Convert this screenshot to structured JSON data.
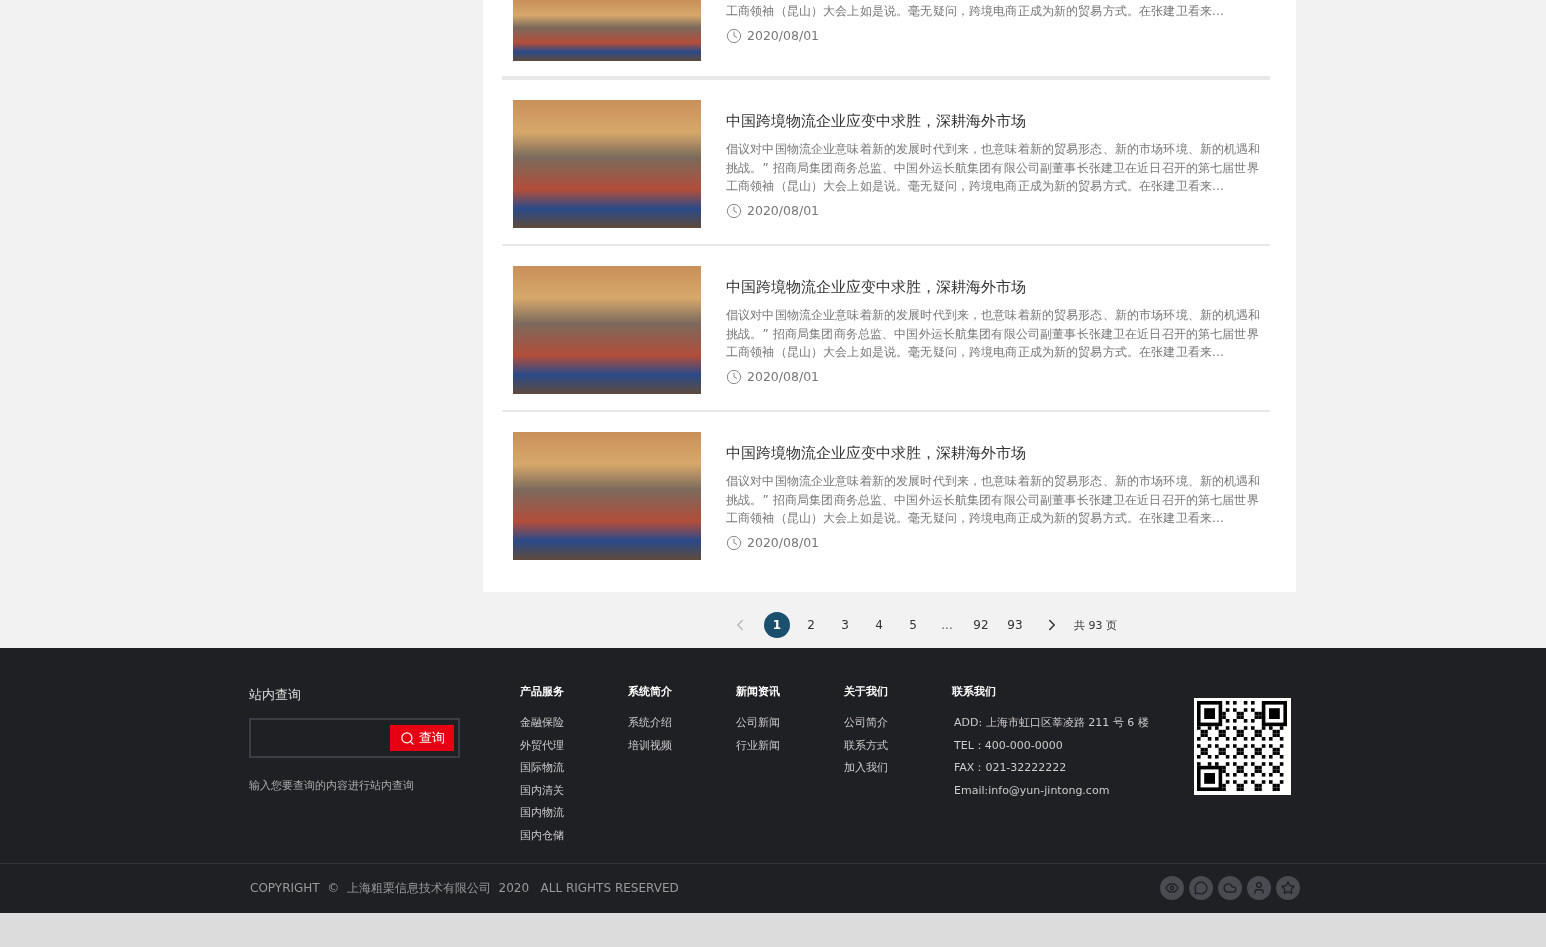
{
  "articles": [
    {
      "partial": true,
      "excerpt": "工商领袖（昆山）大会上如是说。毫无疑问，跨境电商正成为新的贸易方式。在张建卫看来...",
      "date": "2020/08/01"
    },
    {
      "partial": false,
      "title": "中国跨境物流企业应变中求胜，深耕海外市场",
      "excerpt": "倡议对中国物流企业意味着新的发展时代到来，也意味着新的贸易形态、新的市场环境、新的机遇和挑战。” 招商局集团商务总监、中国外运长航集团有限公司副董事长张建卫在近日召开的第七届世界工商领袖（昆山）大会上如是说。毫无疑问，跨境电商正成为新的贸易方式。在张建卫看来...",
      "date": "2020/08/01"
    },
    {
      "partial": false,
      "title": "中国跨境物流企业应变中求胜，深耕海外市场",
      "excerpt": "倡议对中国物流企业意味着新的发展时代到来，也意味着新的贸易形态、新的市场环境、新的机遇和挑战。” 招商局集团商务总监、中国外运长航集团有限公司副董事长张建卫在近日召开的第七届世界工商领袖（昆山）大会上如是说。毫无疑问，跨境电商正成为新的贸易方式。在张建卫看来...",
      "date": "2020/08/01"
    },
    {
      "partial": false,
      "title": "中国跨境物流企业应变中求胜，深耕海外市场",
      "excerpt": "倡议对中国物流企业意味着新的发展时代到来，也意味着新的贸易形态、新的市场环境、新的机遇和挑战。” 招商局集团商务总监、中国外运长航集团有限公司副董事长张建卫在近日召开的第七届世界工商领袖（昆山）大会上如是说。毫无疑问，跨境电商正成为新的贸易方式。在张建卫看来...",
      "date": "2020/08/01"
    }
  ],
  "pagination": {
    "prev_disabled": true,
    "items": [
      {
        "kind": "page",
        "label": "1",
        "selected": true
      },
      {
        "kind": "page",
        "label": "2",
        "selected": false
      },
      {
        "kind": "page",
        "label": "3",
        "selected": false
      },
      {
        "kind": "page",
        "label": "4",
        "selected": false
      },
      {
        "kind": "page",
        "label": "5",
        "selected": false
      },
      {
        "kind": "ellipsis",
        "label": "..."
      },
      {
        "kind": "page",
        "label": "92",
        "selected": false
      },
      {
        "kind": "page",
        "label": "93",
        "selected": false
      }
    ],
    "total": "共 93 页"
  },
  "footer": {
    "search": {
      "title": "站内查询",
      "button": "查询",
      "hint": "输入您要查询的内容进行站内查询"
    },
    "columns": [
      {
        "title": "产品服务",
        "links": [
          "金融保险",
          "外贸代理",
          "国际物流",
          "国内清关",
          "国内物流",
          "国内仓储"
        ]
      },
      {
        "title": "系统简介",
        "links": [
          "系统介绍",
          "培训视频"
        ]
      },
      {
        "title": "新闻资讯",
        "links": [
          "公司新闻",
          "行业新闻"
        ]
      },
      {
        "title": "关于我们",
        "links": [
          "公司简介",
          "联系方式",
          "加入我们"
        ]
      }
    ],
    "contact": {
      "title": "联系我们",
      "lines": [
        "ADD: 上海市虹口区莘凌路 211 号 6 楼",
        "TEL：400-000-0000",
        "FAX：021-32222222",
        "Email:info@yun-jintong.com"
      ]
    },
    "copyright": "COPYRIGHT  ©  上海粗栗信息技术有限公司  2020   ALL RIGHTS RESERVED",
    "social": [
      {
        "kind": "eye"
      },
      {
        "kind": "chat"
      },
      {
        "kind": "cloud"
      },
      {
        "kind": "person"
      },
      {
        "kind": "star"
      }
    ]
  }
}
